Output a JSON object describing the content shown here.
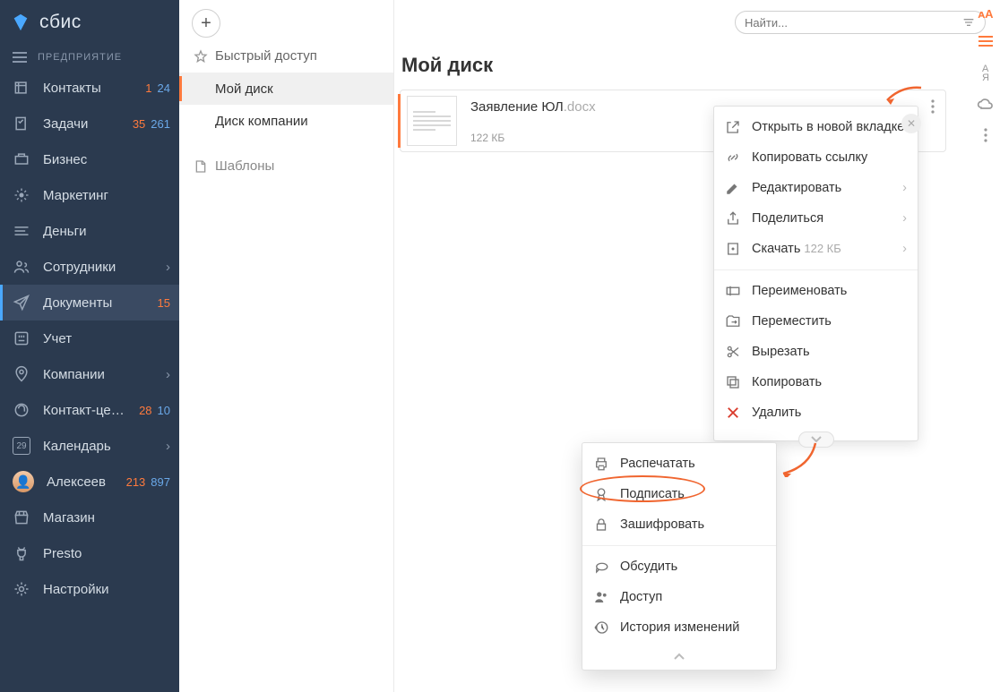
{
  "app": {
    "logo_text": "сбис",
    "org_label": "ПРЕДПРИЯТИЕ"
  },
  "nav": [
    {
      "icon": "contacts",
      "label": "Контакты",
      "b_orange": "1",
      "b_blue": "24"
    },
    {
      "icon": "tasks",
      "label": "Задачи",
      "b_orange": "35",
      "b_blue": "261"
    },
    {
      "icon": "biz",
      "label": "Бизнес"
    },
    {
      "icon": "market",
      "label": "Маркетинг"
    },
    {
      "icon": "money",
      "label": "Деньги"
    },
    {
      "icon": "staff",
      "label": "Сотрудники",
      "chev": true
    },
    {
      "icon": "docs",
      "label": "Документы",
      "b_orange": "15",
      "active": true
    },
    {
      "icon": "acct",
      "label": "Учет"
    },
    {
      "icon": "comp",
      "label": "Компании",
      "chev": true
    },
    {
      "icon": "call",
      "label": "Контакт-центр",
      "b_orange": "28",
      "b_blue": "10"
    },
    {
      "icon": "cal",
      "label": "Календарь",
      "cal_num": "29",
      "chev": true
    },
    {
      "icon": "avatar",
      "label": "Алексеев",
      "b_orange": "213",
      "b_blue": "897"
    },
    {
      "icon": "shop",
      "label": "Магазин"
    },
    {
      "icon": "presto",
      "label": "Presto"
    },
    {
      "icon": "gear",
      "label": "Настройки"
    }
  ],
  "panel2": {
    "fav": "Быстрый доступ",
    "items": [
      "Мой диск",
      "Диск компании"
    ],
    "templates": "Шаблоны"
  },
  "search": {
    "placeholder": "Найти..."
  },
  "page": {
    "title": "Мой диск"
  },
  "file": {
    "name": "Заявление ЮЛ",
    "ext": ".docx",
    "size": "122 КБ"
  },
  "ctx1": {
    "g1": [
      {
        "ico": "open",
        "label": "Открыть в новой вкладке"
      },
      {
        "ico": "link",
        "label": "Копировать ссылку"
      },
      {
        "ico": "edit",
        "label": "Редактировать",
        "chev": true
      },
      {
        "ico": "share",
        "label": "Поделиться",
        "chev": true
      },
      {
        "ico": "dl",
        "label": "Скачать",
        "sub": "122 КБ",
        "chev": true
      }
    ],
    "g2": [
      {
        "ico": "ren",
        "label": "Переименовать"
      },
      {
        "ico": "move",
        "label": "Переместить"
      },
      {
        "ico": "cut",
        "label": "Вырезать"
      },
      {
        "ico": "copy",
        "label": "Копировать"
      },
      {
        "ico": "del",
        "label": "Удалить"
      }
    ]
  },
  "ctx2": {
    "g1": [
      {
        "ico": "print",
        "label": "Распечатать"
      },
      {
        "ico": "sign",
        "label": "Подписать"
      },
      {
        "ico": "lock",
        "label": "Зашифровать"
      }
    ],
    "g2": [
      {
        "ico": "chat",
        "label": "Обсудить"
      },
      {
        "ico": "access",
        "label": "Доступ"
      },
      {
        "ico": "hist",
        "label": "История изменений"
      }
    ]
  },
  "colors": {
    "accent": "#ff7a3d"
  }
}
